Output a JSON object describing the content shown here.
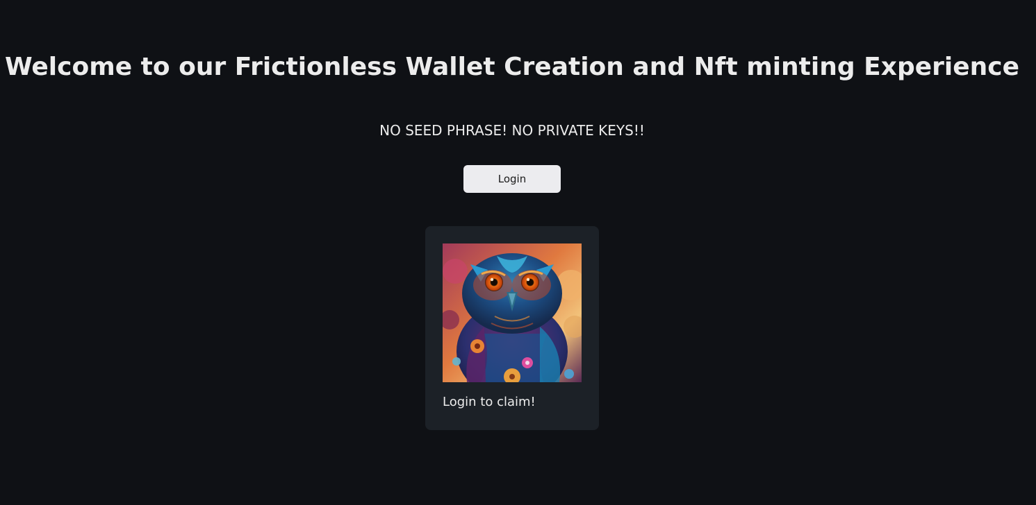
{
  "header": {
    "title": "Welcome to our Frictionless Wallet Creation and Nft minting Experience",
    "tagline": "NO SEED PHRASE! NO PRIVATE KEYS!!"
  },
  "actions": {
    "login_label": "Login"
  },
  "nft_card": {
    "caption": "Login to claim!"
  },
  "theme": {
    "background": "#0f1115",
    "card_background": "#1c2127",
    "button_background": "#ececef",
    "text": "#ececec"
  }
}
